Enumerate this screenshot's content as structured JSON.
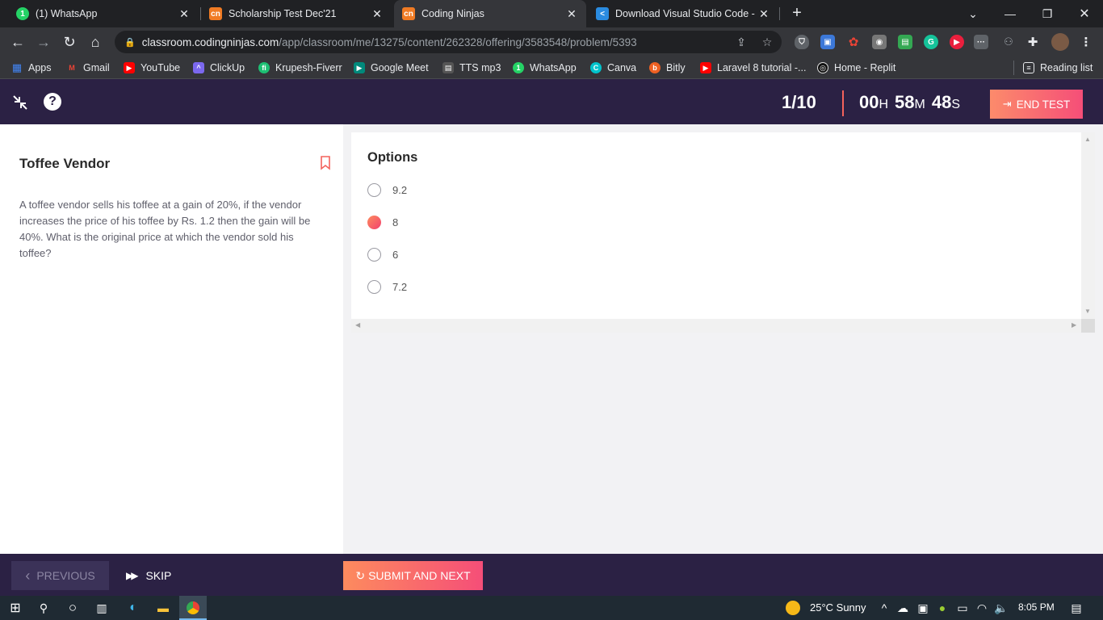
{
  "browser": {
    "tabs": [
      {
        "title": "(1) WhatsApp",
        "icon": "whatsapp-icon",
        "color": "#25d366",
        "glyph": "1"
      },
      {
        "title": "Scholarship Test Dec'21",
        "icon": "codingninjas-icon",
        "color": "#f07b24",
        "glyph": "cn"
      },
      {
        "title": "Coding Ninjas",
        "icon": "codingninjas-icon",
        "color": "#f07b24",
        "glyph": "cn"
      },
      {
        "title": "Download Visual Studio Code - M",
        "icon": "vscode-icon",
        "color": "#2a8be0",
        "glyph": "<"
      }
    ],
    "new_tab_label": "+",
    "url_host": "classroom.codingninjas.com",
    "url_path": "/app/classroom/me/13275/content/262328/offering/3583548/problem/5393",
    "bookmarks": [
      {
        "label": "Apps",
        "icon": "apps-grid-icon",
        "color": "#4285f4",
        "glyph": "▦"
      },
      {
        "label": "Gmail",
        "icon": "gmail-icon",
        "color": "#ea4335",
        "glyph": "M"
      },
      {
        "label": "YouTube",
        "icon": "youtube-icon",
        "color": "#ff0000",
        "glyph": "▶"
      },
      {
        "label": "ClickUp",
        "icon": "clickup-icon",
        "color": "#7b68ee",
        "glyph": "^"
      },
      {
        "label": "Krupesh-Fiverr",
        "icon": "fiverr-icon",
        "color": "#1dbf73",
        "glyph": "fi"
      },
      {
        "label": "Google Meet",
        "icon": "google-meet-icon",
        "color": "#00897b",
        "glyph": "▶"
      },
      {
        "label": "TTS mp3",
        "icon": "tts-icon",
        "color": "#555555",
        "glyph": "▤"
      },
      {
        "label": "WhatsApp",
        "icon": "whatsapp-icon",
        "color": "#25d366",
        "glyph": "1"
      },
      {
        "label": "Canva",
        "icon": "canva-icon",
        "color": "#00c4cc",
        "glyph": "C"
      },
      {
        "label": "Bitly",
        "icon": "bitly-icon",
        "color": "#ee6123",
        "glyph": "b"
      },
      {
        "label": "Laravel 8 tutorial -...",
        "icon": "youtube-icon",
        "color": "#ff0000",
        "glyph": "▶"
      },
      {
        "label": "Home - Replit",
        "icon": "replit-icon",
        "color": "#f26207",
        "glyph": "◎"
      }
    ],
    "reading_list": "Reading list"
  },
  "header": {
    "progress": "1/10",
    "timer": {
      "hours": "00",
      "h_unit": "H",
      "minutes": "58",
      "m_unit": "M",
      "seconds": "48",
      "s_unit": "S"
    },
    "end_test_label": "END TEST"
  },
  "question": {
    "title": "Toffee Vendor",
    "body": "A toffee vendor sells his toffee at a gain of 20%, if the vendor increases the price of his toffee by Rs. 1.2 then the gain will be 40%. What is the original price at which the vendor sold his toffee?"
  },
  "options": {
    "heading": "Options",
    "items": [
      {
        "label": "9.2",
        "selected": false
      },
      {
        "label": "8",
        "selected": true
      },
      {
        "label": "6",
        "selected": false
      },
      {
        "label": "7.2",
        "selected": false
      }
    ]
  },
  "footer": {
    "previous_label": "PREVIOUS",
    "skip_label": "SKIP",
    "submit_label": "SUBMIT AND NEXT"
  },
  "taskbar": {
    "weather": "25°C  Sunny",
    "time": "8:05 PM"
  },
  "colors": {
    "header_bg": "#2b2144",
    "accent_start": "#fd8b5e",
    "accent_end": "#f54e78"
  }
}
